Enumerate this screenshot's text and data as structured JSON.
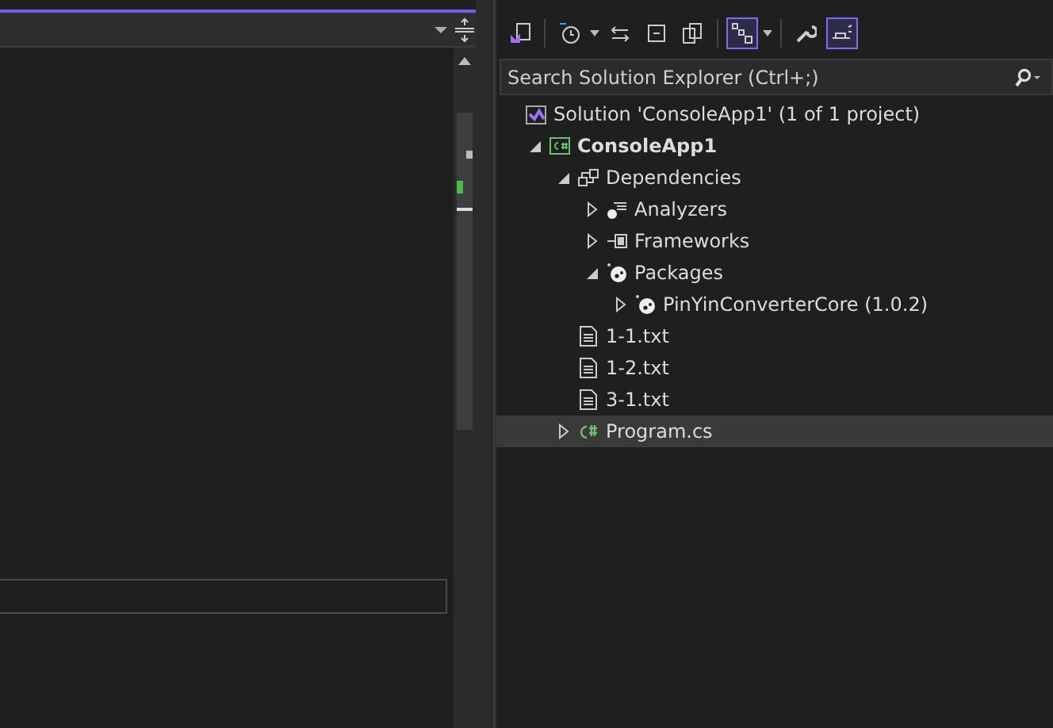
{
  "toolbar": [
    {
      "kind": "vs",
      "selected": false
    },
    {
      "kind": "sep"
    },
    {
      "kind": "history",
      "selected": false
    },
    {
      "kind": "caret"
    },
    {
      "kind": "sync",
      "selected": false
    },
    {
      "kind": "collapse",
      "selected": false
    },
    {
      "kind": "copies",
      "selected": false
    },
    {
      "kind": "sep"
    },
    {
      "kind": "tree",
      "selected": true
    },
    {
      "kind": "caret"
    },
    {
      "kind": "sep"
    },
    {
      "kind": "wrench",
      "selected": false
    },
    {
      "kind": "preview",
      "selected": true
    }
  ],
  "search": {
    "placeholder": "Search Solution Explorer (Ctrl+;)"
  },
  "tree": [
    {
      "label": "Solution 'ConsoleApp1' (1 of 1 project)",
      "kind": "solution",
      "selected": false,
      "children": [
        {
          "label": "ConsoleApp1",
          "kind": "project",
          "bold": true,
          "expanded": true,
          "selected": false,
          "children": [
            {
              "label": "Dependencies",
              "kind": "deps",
              "expanded": true,
              "selected": false,
              "children": [
                {
                  "label": "Analyzers",
                  "kind": "analyzers",
                  "expanded": false,
                  "selected": false
                },
                {
                  "label": "Frameworks",
                  "kind": "frameworks",
                  "expanded": false,
                  "selected": false
                },
                {
                  "label": "Packages",
                  "kind": "package",
                  "expanded": true,
                  "selected": false,
                  "children": [
                    {
                      "label": "PinYinConverterCore (1.0.2)",
                      "kind": "package",
                      "expanded": false,
                      "selected": false
                    }
                  ]
                }
              ]
            },
            {
              "label": "1-1.txt",
              "kind": "file",
              "selected": false
            },
            {
              "label": "1-2.txt",
              "kind": "file",
              "selected": false
            },
            {
              "label": "3-1.txt",
              "kind": "file",
              "selected": false
            },
            {
              "label": "Program.cs",
              "kind": "csharp",
              "expanded": false,
              "selected": true
            }
          ]
        }
      ]
    }
  ]
}
